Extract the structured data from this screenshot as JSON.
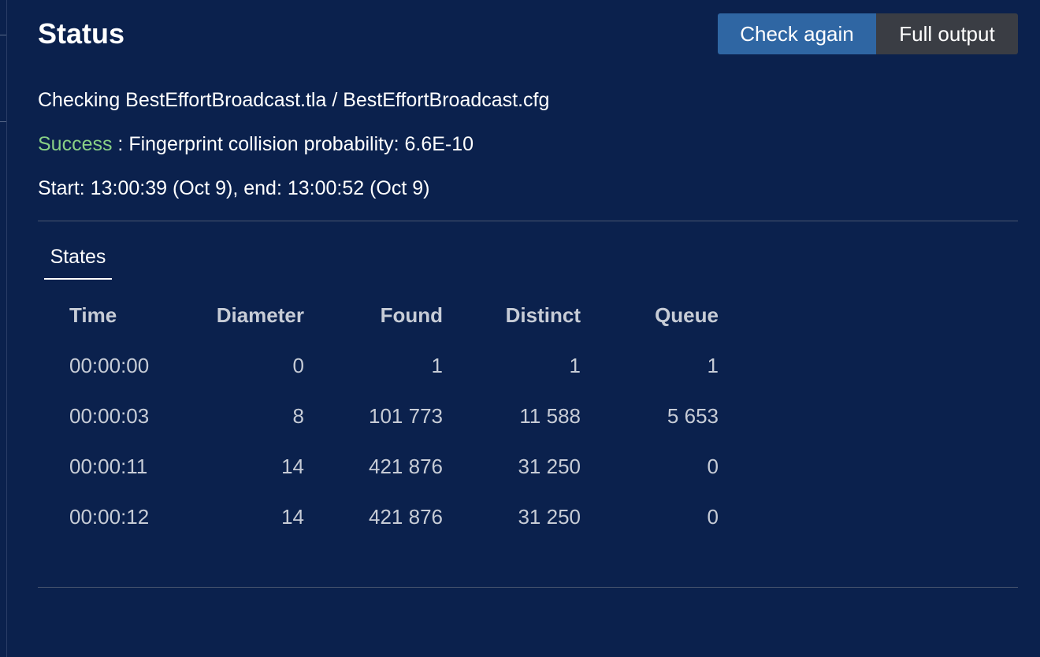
{
  "header": {
    "title": "Status",
    "check_again_label": "Check again",
    "full_output_label": "Full output"
  },
  "status": {
    "checking_text": "Checking BestEffortBroadcast.tla / BestEffortBroadcast.cfg",
    "success_label": "Success",
    "success_detail": " : Fingerprint collision probability: 6.6E-10",
    "timing_text": "Start: 13:00:39 (Oct 9), end: 13:00:52 (Oct 9)"
  },
  "tabs": [
    {
      "label": "States",
      "active": true
    }
  ],
  "table": {
    "columns": [
      "Time",
      "Diameter",
      "Found",
      "Distinct",
      "Queue"
    ],
    "rows": [
      [
        "00:00:00",
        "0",
        "1",
        "1",
        "1"
      ],
      [
        "00:00:03",
        "8",
        "101 773",
        "11 588",
        "5 653"
      ],
      [
        "00:00:11",
        "14",
        "421 876",
        "31 250",
        "0"
      ],
      [
        "00:00:12",
        "14",
        "421 876",
        "31 250",
        "0"
      ]
    ]
  },
  "colors": {
    "background": "#0b214d",
    "primary_button": "#2f66a3",
    "secondary_button": "#3a3d44",
    "success": "#89d185"
  }
}
